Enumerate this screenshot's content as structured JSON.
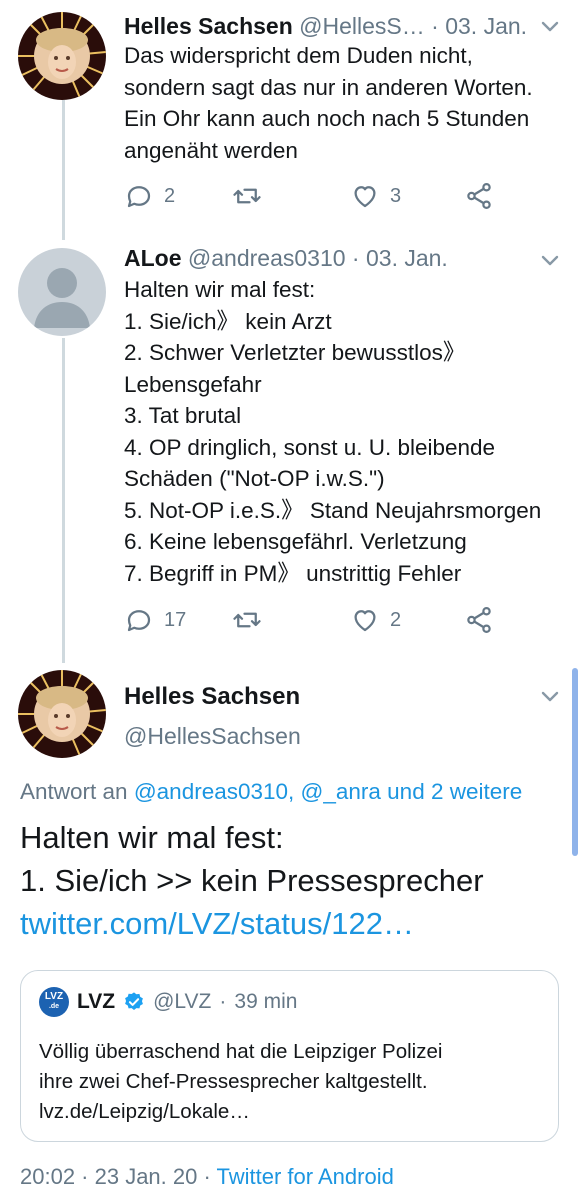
{
  "tweets": [
    {
      "display_name": "Helles Sachsen",
      "handle": "@HellesS…",
      "separator": "·",
      "date": "03. Jan.",
      "text": "Das widerspricht dem Duden nicht,\nsondern sagt das nur in anderen Worten.\nEin Ohr kann auch noch nach 5 Stunden\nangenäht werden",
      "replies": "2",
      "retweets": "",
      "likes": "3"
    },
    {
      "display_name": "ALoe",
      "handle": "@andreas0310",
      "separator": "·",
      "date": "03. Jan.",
      "text": "Halten wir mal fest:\n1. Sie/ich》 kein Arzt\n2. Schwer Verletzter bewusstlos》\nLebensgefahr\n3. Tat brutal\n4. OP dringlich, sonst u. U. bleibende\nSchäden (\"Not-OP i.w.S.\")\n5. Not-OP i.e.S.》 Stand Neujahrsmorgen\n6. Keine lebensgefährl. Verletzung\n7. Begriff in PM》 unstrittig Fehler",
      "replies": "17",
      "retweets": "",
      "likes": "2"
    }
  ],
  "focused": {
    "display_name": "Helles Sachsen",
    "handle": "@HellesSachsen",
    "reply_prefix": "Antwort an",
    "reply_targets": "@andreas0310, @_anra und 2 weitere",
    "line1": "Halten wir mal fest:",
    "line2": "1. Sie/ich >> kein Pressesprecher",
    "link": "twitter.com/LVZ/status/122…",
    "quote": {
      "logo_text": "LVZ",
      "logo_sub": ".de",
      "name": "LVZ",
      "handle": "@LVZ",
      "separator": "·",
      "time": "39 min",
      "line1": "Völlig überraschend hat die Leipziger Polizei",
      "line2": "ihre zwei Chef-Pressesprecher kaltgestellt.",
      "line3": "lvz.de/Leipzig/Lokale…"
    },
    "timestamp": "20:02 · 23 Jan. 20 ·",
    "client": "Twitter for Android"
  },
  "colors": {
    "accent": "#1b95e0",
    "muted": "#657786",
    "thread_line": "#cfd9de",
    "verified": "#1da1f2"
  }
}
